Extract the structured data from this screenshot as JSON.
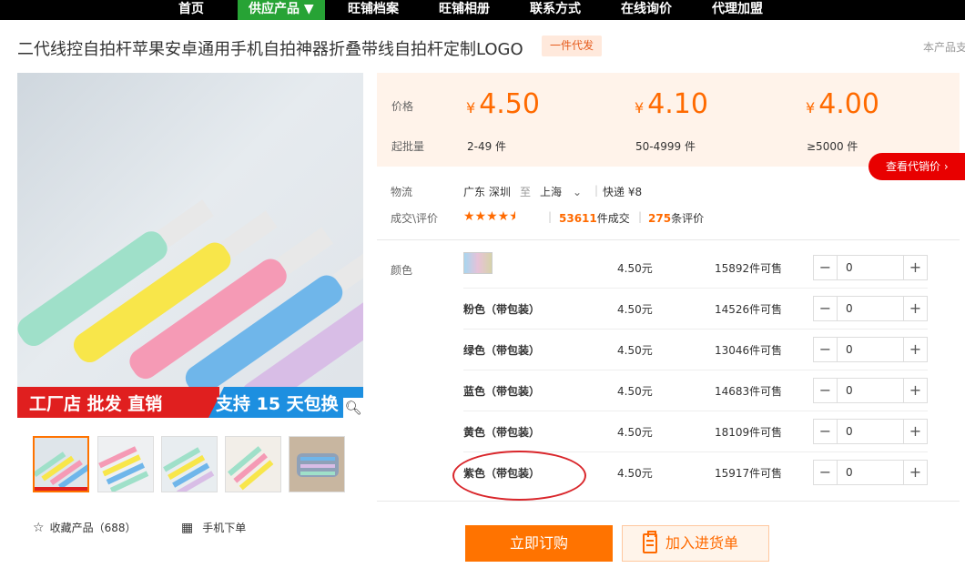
{
  "nav": [
    "首页",
    "供应产品 ▼",
    "旺铺档案",
    "旺铺相册",
    "联系方式",
    "在线询价",
    "代理加盟"
  ],
  "product": {
    "title": "二代线控自拍杆苹果安卓通用手机自拍神器折叠带线自拍杆定制LOGO",
    "tag": "一件代发",
    "side_note": "本产品支"
  },
  "banner": {
    "left_text": "工厂店  批发  直销",
    "right_text": "支持 15 天包换"
  },
  "price_section": {
    "price_label": "价格",
    "moq_label": "起批量",
    "tiers": [
      {
        "currency": "¥",
        "price": "4.50",
        "range": "2-49 件"
      },
      {
        "currency": "¥",
        "price": "4.10",
        "range": "50-4999 件"
      },
      {
        "currency": "¥",
        "price": "4.00",
        "range": "≥5000 件"
      }
    ],
    "agent_button": "查看代销价 ›"
  },
  "logistics": {
    "label": "物流",
    "from": "广东 深圳",
    "to_word": "至",
    "to": "上海",
    "express": "快递 ¥8"
  },
  "reviews": {
    "label": "成交\\评价",
    "rating": 4.5,
    "deals_count": "53611",
    "deals_word": "件成交",
    "review_count": "275",
    "review_word": "条评价"
  },
  "sku": {
    "label": "颜色",
    "rows": [
      {
        "name": "",
        "price": "4.50元",
        "stock": "15892件可售",
        "qty": "0",
        "has_thumb": true
      },
      {
        "name": "粉色（带包装）",
        "price": "4.50元",
        "stock": "14526件可售",
        "qty": "0"
      },
      {
        "name": "绿色（带包装）",
        "price": "4.50元",
        "stock": "13046件可售",
        "qty": "0"
      },
      {
        "name": "蓝色（带包装）",
        "price": "4.50元",
        "stock": "14683件可售",
        "qty": "0"
      },
      {
        "name": "黄色（带包装）",
        "price": "4.50元",
        "stock": "18109件可售",
        "qty": "0"
      },
      {
        "name": "紫色（带包装）",
        "price": "4.50元",
        "stock": "15917件可售",
        "qty": "0"
      }
    ]
  },
  "actions": {
    "buy": "立即订购",
    "cart": "加入进货单",
    "favorite": "收藏产品（688）",
    "mobile_order": "手机下单"
  },
  "colors": {
    "accent": "#ff7300",
    "nav_active": "#27a335",
    "price": "#ff6a00",
    "highlight": "#d9262b"
  }
}
